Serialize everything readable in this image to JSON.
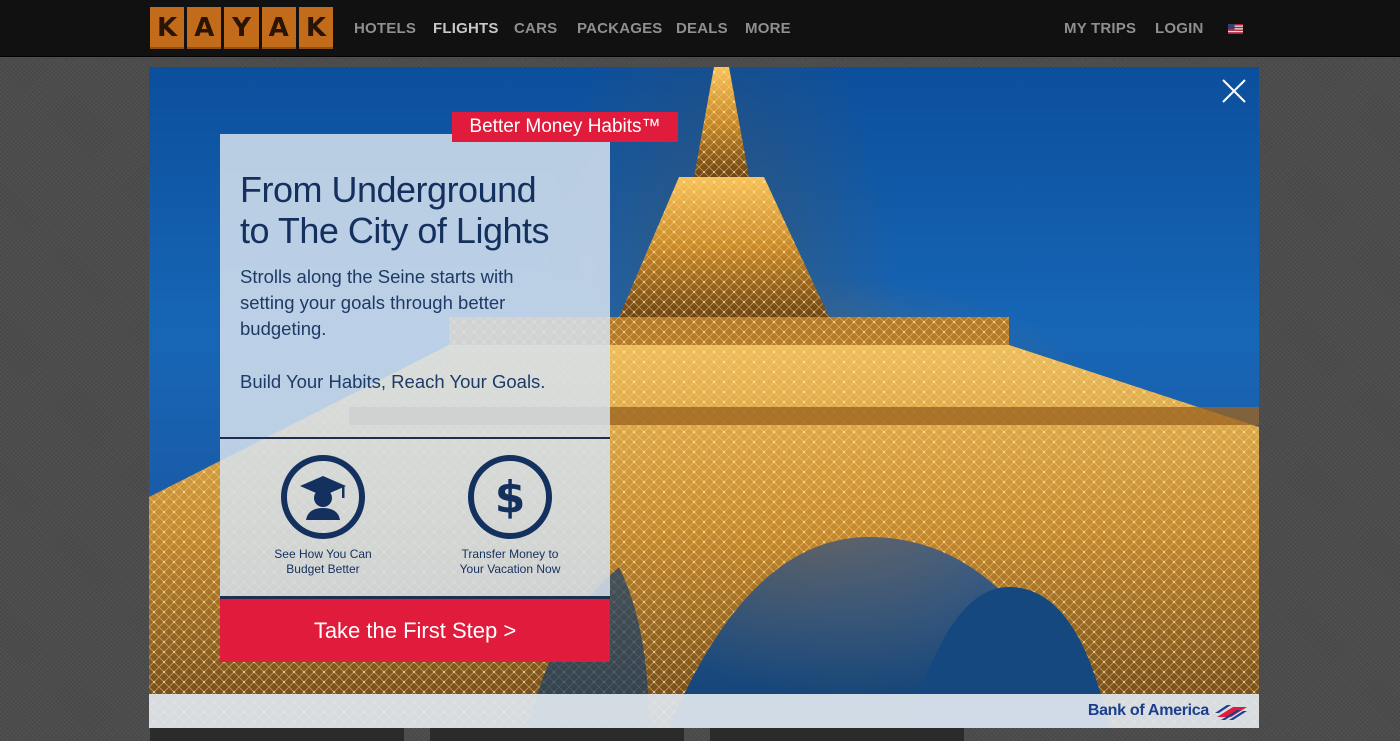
{
  "nav": {
    "logo_letters": [
      "K",
      "A",
      "Y",
      "A",
      "K"
    ],
    "items": [
      {
        "label": "HOTELS",
        "active": false
      },
      {
        "label": "FLIGHTS",
        "active": true
      },
      {
        "label": "CARS",
        "active": false
      },
      {
        "label": "PACKAGES",
        "active": false
      },
      {
        "label": "DEALS",
        "active": false
      },
      {
        "label": "MORE",
        "active": false
      }
    ],
    "right_items": [
      {
        "label": "MY TRIPS"
      },
      {
        "label": "LOGIN"
      }
    ],
    "flag_icon": "us-flag-icon"
  },
  "modal": {
    "badge": "Better Money Habits™",
    "headline_line1": "From Underground",
    "headline_line2": "to The City of Lights",
    "body_line1": "Strolls along the Seine starts with",
    "body_line2": "setting your goals through better",
    "body_line3": "budgeting.",
    "goals": "Build Your Habits, Reach Your Goals.",
    "actions": [
      {
        "icon": "graduate-icon",
        "line1": "See How You Can",
        "line2": "Budget Better"
      },
      {
        "icon": "dollar-icon",
        "line1": "Transfer Money to",
        "line2": "Your Vacation Now"
      }
    ],
    "cta": "Take the First Step >",
    "sponsor": "Bank of America",
    "close_icon": "close-icon"
  },
  "colors": {
    "brand_red": "#e01b3b",
    "navy": "#14305e",
    "kayak_orange": "#c26b1a"
  }
}
